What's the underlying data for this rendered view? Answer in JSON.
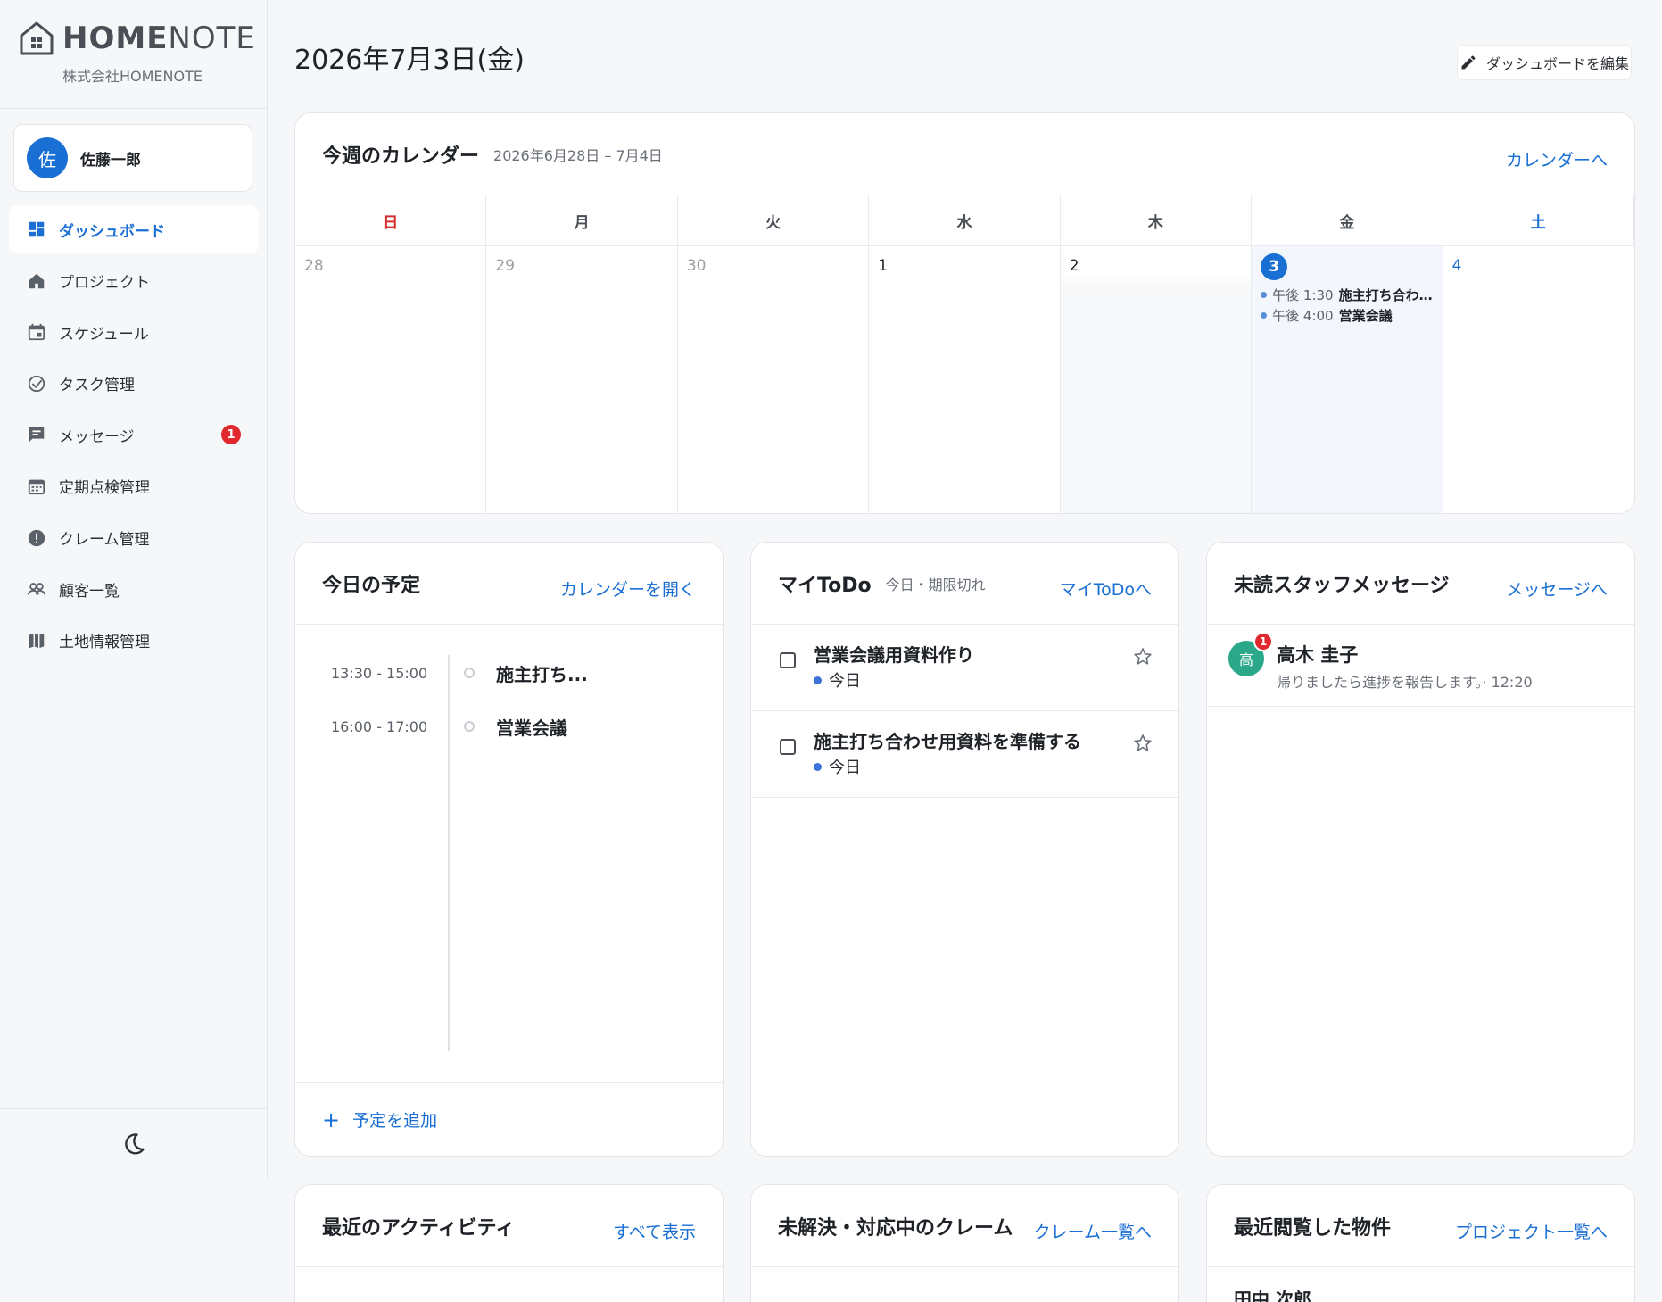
{
  "brand": {
    "name_bold": "HOME",
    "name_light": "NOTE",
    "company": "株式会社HOMENOTE"
  },
  "user": {
    "initial": "佐",
    "name": "佐藤一郎"
  },
  "nav": [
    {
      "label": "ダッシュボード",
      "icon": "dashboard-icon",
      "active": true
    },
    {
      "label": "プロジェクト",
      "icon": "home-icon"
    },
    {
      "label": "スケジュール",
      "icon": "calendar-icon"
    },
    {
      "label": "タスク管理",
      "icon": "check-circle-icon"
    },
    {
      "label": "メッセージ",
      "icon": "chat-icon",
      "badge": "1"
    },
    {
      "label": "定期点検管理",
      "icon": "calendar-grid-icon"
    },
    {
      "label": "クレーム管理",
      "icon": "alert-icon"
    },
    {
      "label": "顧客一覧",
      "icon": "people-icon"
    },
    {
      "label": "土地情報管理",
      "icon": "map-icon"
    }
  ],
  "header": {
    "date": "2026年7月3日(金)",
    "edit_label": "ダッシュボードを編集"
  },
  "calendar": {
    "title": "今週のカレンダー",
    "range": "2026年6月28日 – 7月4日",
    "link": "カレンダーへ",
    "dows": [
      "日",
      "月",
      "火",
      "水",
      "木",
      "金",
      "土"
    ],
    "days": [
      "28",
      "29",
      "30",
      "1",
      "2",
      "3",
      "4"
    ],
    "events": [
      {
        "time": "午後 1:30",
        "name": "施主打ち合わ…"
      },
      {
        "time": "午後 4:00",
        "name": "営業会議"
      }
    ]
  },
  "today": {
    "title": "今日の予定",
    "link": "カレンダーを開く",
    "items": [
      {
        "time": "13:30 - 15:00",
        "name": "施主打ち..."
      },
      {
        "time": "16:00 - 17:00",
        "name": "営業会議"
      }
    ],
    "add_label": "予定を追加"
  },
  "todo": {
    "title": "マイToDo",
    "sub": "今日・期限切れ",
    "link": "マイToDoへ",
    "items": [
      {
        "title": "営業会議用資料作り",
        "due": "今日"
      },
      {
        "title": "施主打ち合わせ用資料を準備する",
        "due": "今日"
      }
    ]
  },
  "messages": {
    "title": "未読スタッフメッセージ",
    "link": "メッセージへ",
    "items": [
      {
        "initial": "高",
        "badge": "1",
        "name": "高木 圭子",
        "preview": "帰りましたら進捗を報告します。· 12:20"
      }
    ]
  },
  "activity": {
    "title": "最近のアクティビティ",
    "link": "すべて表示"
  },
  "claims": {
    "title": "未解決・対応中のクレーム",
    "link": "クレーム一覧へ"
  },
  "recent": {
    "title": "最近閲覧した物件",
    "link": "プロジェクト一覧へ",
    "first": "田中 次郎"
  },
  "colors": {
    "accent": "#1a6fd4",
    "badge": "#e0282e",
    "today_bg": "#f3f7fc"
  }
}
